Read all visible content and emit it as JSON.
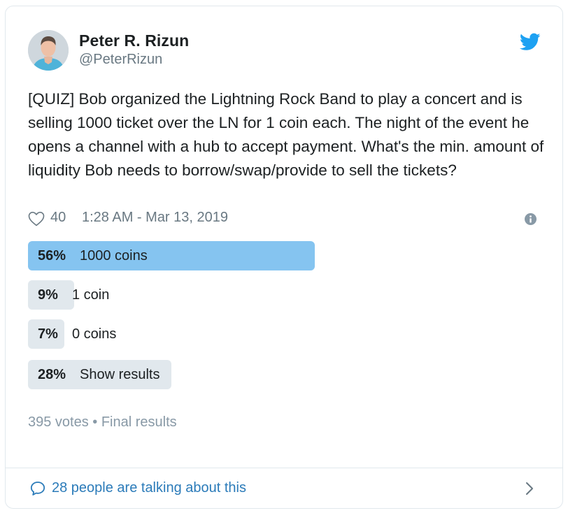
{
  "author": {
    "name": "Peter R. Rizun",
    "handle": "@PeterRizun"
  },
  "tweet": {
    "text": "[QUIZ] Bob organized the Lightning Rock Band to play a concert and is selling 1000 ticket over the LN for 1 coin each. The night of the event he opens a channel with a hub to accept payment. What's the min. amount of liquidity Bob needs to borrow/swap/provide to sell the tickets?",
    "likes": "40",
    "timestamp": "1:28 AM - Mar 13, 2019"
  },
  "poll": {
    "options": [
      {
        "percent": "56%",
        "percent_value": 56,
        "label": "1000 coins",
        "winner": true
      },
      {
        "percent": "9%",
        "percent_value": 9,
        "label": "1 coin",
        "winner": false
      },
      {
        "percent": "7%",
        "percent_value": 7,
        "label": "0 coins",
        "winner": false
      },
      {
        "percent": "28%",
        "percent_value": 28,
        "label": "Show results",
        "winner": false
      }
    ],
    "footer": "395 votes • Final results"
  },
  "conversation": {
    "label": "28 people are talking about this"
  },
  "colors": {
    "twitter_blue": "#1da1f2",
    "winner_bar": "#85c4f0",
    "bar": "#e1e8ed",
    "link": "#2b7bb9",
    "muted": "#697882"
  },
  "icons": [
    "twitter-bird-icon",
    "heart-icon",
    "info-icon",
    "speech-bubble-icon",
    "chevron-right-icon"
  ]
}
